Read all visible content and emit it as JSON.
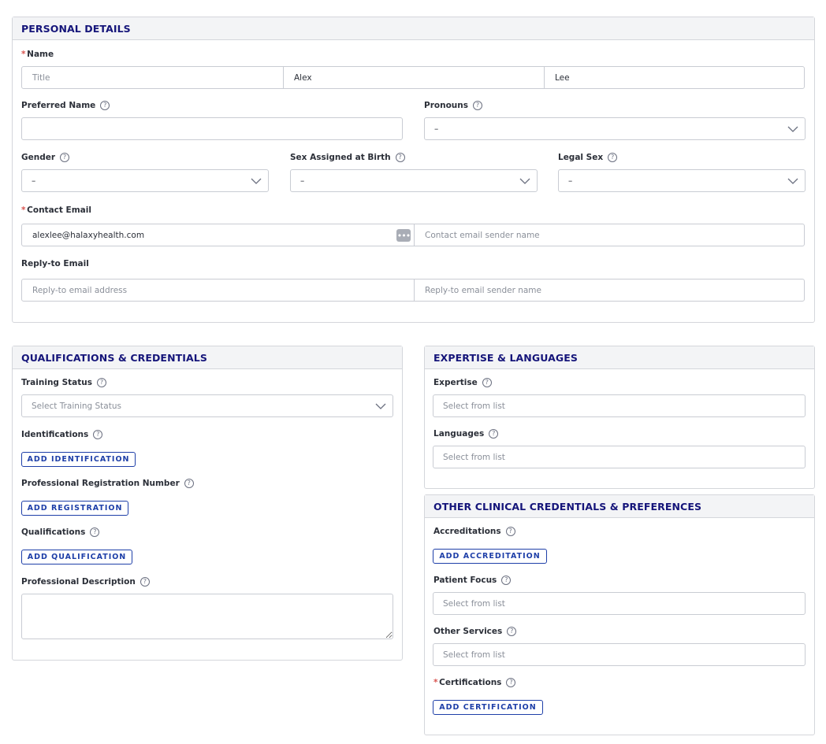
{
  "personal": {
    "title": "PERSONAL DETAILS",
    "name_label": "Name",
    "name_title_placeholder": "Title",
    "first_name": "Alex",
    "last_name": "Lee",
    "preferred_name_label": "Preferred Name",
    "preferred_name_value": "",
    "pronouns_label": "Pronouns",
    "pronouns_value": "–",
    "gender_label": "Gender",
    "gender_value": "–",
    "sex_at_birth_label": "Sex Assigned at Birth",
    "sex_at_birth_value": "–",
    "legal_sex_label": "Legal Sex",
    "legal_sex_value": "–",
    "contact_email_label": "Contact Email",
    "contact_email_value": "alexlee@halaxyhealth.com",
    "contact_sender_placeholder": "Contact email sender name",
    "reply_to_label": "Reply-to Email",
    "reply_to_address_placeholder": "Reply-to email address",
    "reply_to_sender_placeholder": "Reply-to email sender name"
  },
  "qualifications": {
    "title": "QUALIFICATIONS & CREDENTIALS",
    "training_status_label": "Training Status",
    "training_status_placeholder": "Select Training Status",
    "identifications_label": "Identifications",
    "add_identification": "ADD IDENTIFICATION",
    "registration_label": "Professional Registration Number",
    "add_registration": "ADD REGISTRATION",
    "qualifications_label": "Qualifications",
    "add_qualification": "ADD QUALIFICATION",
    "description_label": "Professional Description"
  },
  "expertise": {
    "title": "EXPERTISE & LANGUAGES",
    "expertise_label": "Expertise",
    "expertise_placeholder": "Select from list",
    "languages_label": "Languages",
    "languages_placeholder": "Select from list"
  },
  "other": {
    "title": "OTHER CLINICAL CREDENTIALS & PREFERENCES",
    "accreditations_label": "Accreditations",
    "add_accreditation": "ADD ACCREDITATION",
    "patient_focus_label": "Patient Focus",
    "patient_focus_placeholder": "Select from list",
    "other_services_label": "Other Services",
    "other_services_placeholder": "Select from list",
    "certifications_label": "Certifications",
    "add_certification": "ADD CERTIFICATION"
  },
  "common": {
    "required_mark": "*",
    "help_glyph": "?"
  },
  "colors": {
    "heading": "#15157a",
    "button": "#1e3fa8",
    "required": "#d9534f",
    "border": "#c9ccd3",
    "header_bg": "#f3f4f6"
  }
}
